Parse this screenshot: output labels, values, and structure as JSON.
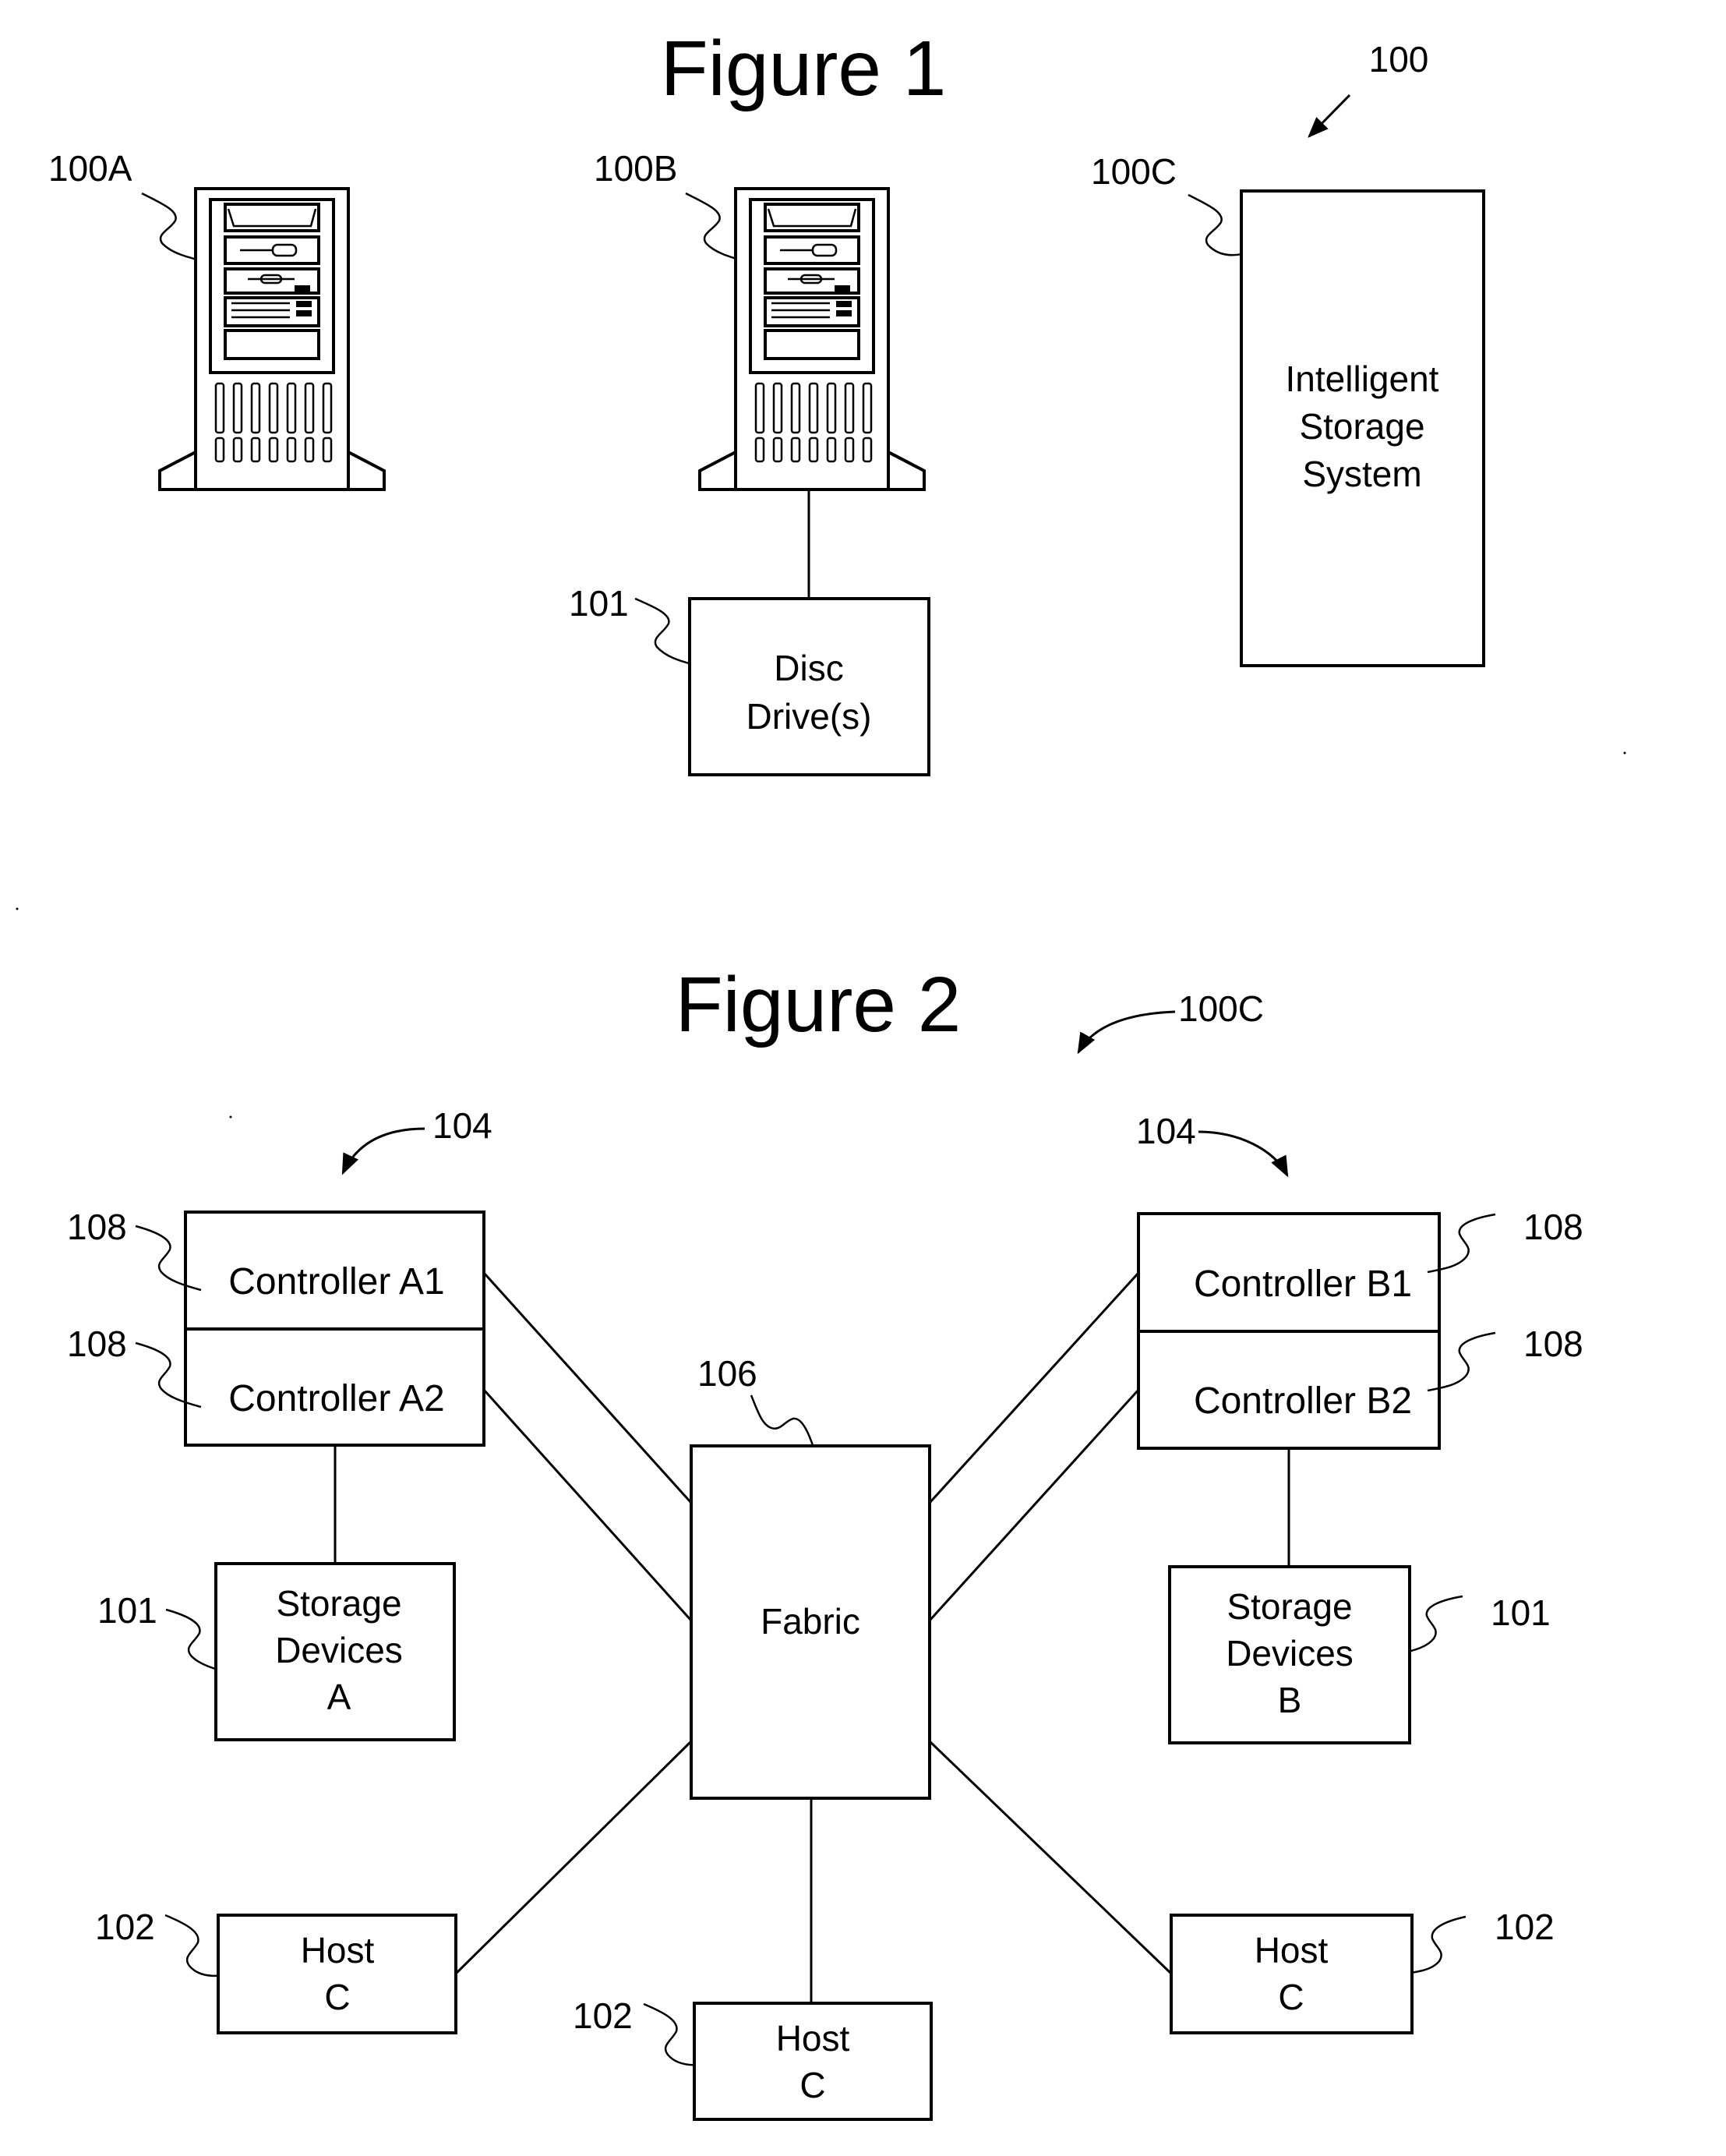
{
  "figure1": {
    "title": "Figure 1",
    "system_ref": "100",
    "server_a": {
      "ref": "100A"
    },
    "server_b": {
      "ref": "100B"
    },
    "disc_drive": {
      "ref": "101",
      "lines": [
        "Disc",
        "Drive(s)"
      ]
    },
    "intelligent_storage": {
      "ref": "100C",
      "lines": [
        "Intelligent",
        "Storage",
        "System"
      ]
    }
  },
  "figure2": {
    "title": "Figure 2",
    "system_ref": "100C",
    "left_group": {
      "group_ref": "104",
      "controllers": [
        {
          "ref": "108",
          "label": "Controller A1"
        },
        {
          "ref": "108",
          "label": "Controller A2"
        }
      ],
      "storage": {
        "ref": "101",
        "lines": [
          "Storage",
          "Devices",
          "A"
        ]
      }
    },
    "right_group": {
      "group_ref": "104",
      "controllers": [
        {
          "ref": "108",
          "label": "Controller B1"
        },
        {
          "ref": "108",
          "label": "Controller B2"
        }
      ],
      "storage": {
        "ref": "101",
        "lines": [
          "Storage",
          "Devices",
          "B"
        ]
      }
    },
    "fabric": {
      "ref": "106",
      "label": "Fabric"
    },
    "hosts": [
      {
        "ref": "102",
        "lines": [
          "Host",
          "C"
        ]
      },
      {
        "ref": "102",
        "lines": [
          "Host",
          "C"
        ]
      },
      {
        "ref": "102",
        "lines": [
          "Host",
          "C"
        ]
      }
    ]
  }
}
